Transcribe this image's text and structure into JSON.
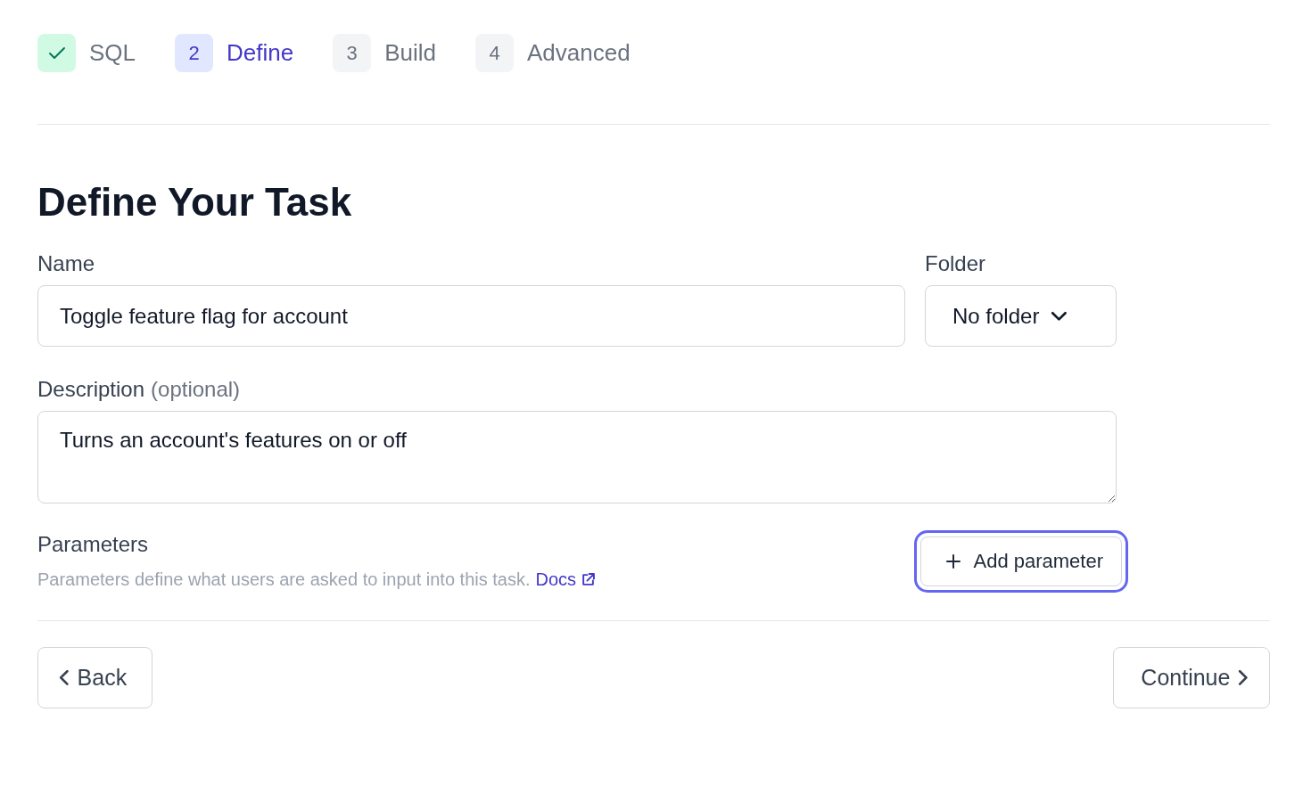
{
  "steps": [
    {
      "label": "SQL",
      "completed": true,
      "selected": false
    },
    {
      "number": "2",
      "label": "Define",
      "completed": false,
      "selected": true
    },
    {
      "number": "3",
      "label": "Build",
      "completed": false,
      "selected": false
    },
    {
      "number": "4",
      "label": "Advanced",
      "completed": false,
      "selected": false
    }
  ],
  "title": "Define Your Task",
  "name_field": {
    "label": "Name",
    "value": "Toggle feature flag for account"
  },
  "folder_field": {
    "label": "Folder",
    "value": "No folder"
  },
  "description_field": {
    "label": "Description",
    "hint": "(optional)",
    "value": "Turns an account's features on or off"
  },
  "parameters": {
    "title": "Parameters",
    "text": "Parameters define what users are asked to input into this task.",
    "link": "Docs",
    "button": {
      "label": "Add parameter",
      "focused": true
    }
  },
  "footer": {
    "back": "Back",
    "continue": "Continue"
  }
}
